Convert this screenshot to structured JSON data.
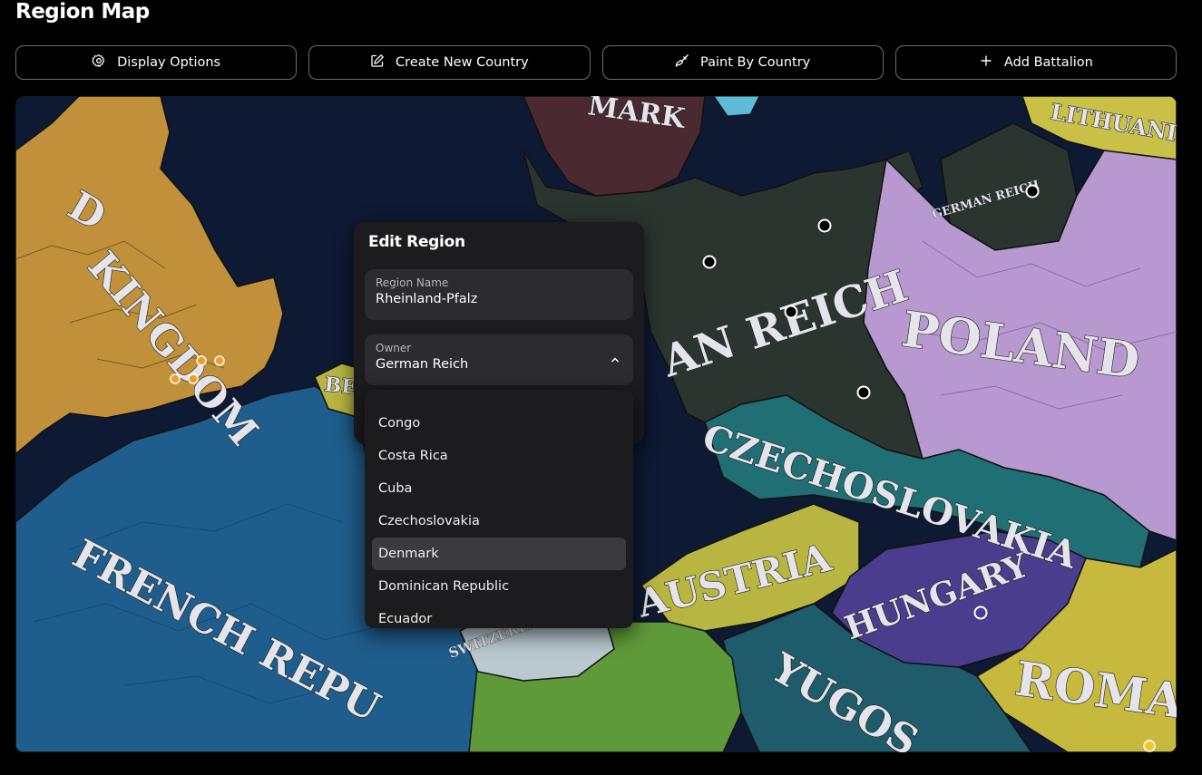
{
  "page": {
    "title": "Region Map"
  },
  "toolbar": {
    "buttons": [
      {
        "label": "Display Options",
        "icon": "gear-icon"
      },
      {
        "label": "Create New Country",
        "icon": "edit-icon"
      },
      {
        "label": "Paint By Country",
        "icon": "paint-brush-icon"
      },
      {
        "label": "Add Battalion",
        "icon": "plus-icon"
      }
    ]
  },
  "map": {
    "labels": {
      "kingdom": "KINGDOM",
      "kingdom_prefix": "D",
      "denmark": "MARK",
      "lithuania": "LITHUANI",
      "german_reich_small": "GERMAN REICH",
      "german_reich": "AN REICH",
      "poland": "POLAND",
      "belgium": "BE",
      "czechoslovakia": "CZECHOSLOVAKIA",
      "austria": "AUSTRIA",
      "hungary": "HUNGARY",
      "french_republic": "FRENCH REPU",
      "switzerland": "SWITZERLAND",
      "yugoslavia": "YUGOS",
      "romania": "ROMA"
    },
    "colors": {
      "sea": "#0e1a33",
      "uk": "#c0913a",
      "germany": "#2b3530",
      "poland": "#b799cf",
      "france": "#1f5d8c",
      "czech": "#1f6f74",
      "austria": "#b8b540",
      "hungary": "#4a3d8e",
      "yugoslavia": "#1e5b6b",
      "romania": "#c7b93e",
      "switzerland": "#b9c9cf",
      "italy": "#5f9a3a",
      "denmark": "#5a2d38",
      "lithuania": "#c9c048"
    }
  },
  "edit_region": {
    "title": "Edit Region",
    "region_name_label": "Region Name",
    "region_name_value": "Rheinland-Pfalz",
    "owner_label": "Owner",
    "owner_value": "German Reich"
  },
  "owner_options": [
    {
      "label": "Congo"
    },
    {
      "label": "Costa Rica"
    },
    {
      "label": "Cuba"
    },
    {
      "label": "Czechoslovakia"
    },
    {
      "label": "Denmark",
      "selected": true
    },
    {
      "label": "Dominican Republic"
    },
    {
      "label": "Ecuador"
    }
  ]
}
